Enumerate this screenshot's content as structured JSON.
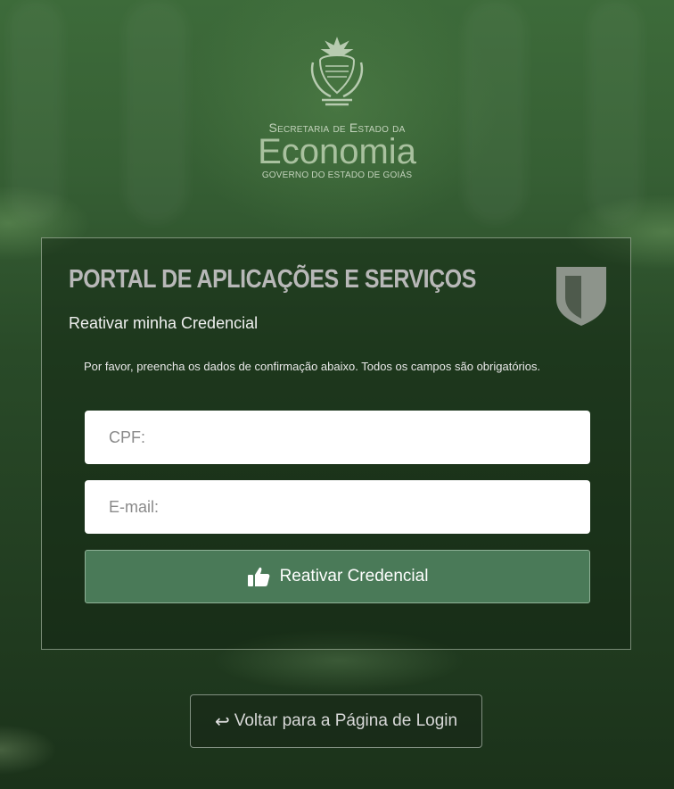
{
  "logo": {
    "line1": "Secretaria de Estado da",
    "line2": "Economia",
    "line3": "GOVERNO DO ESTADO DE GOIÁS"
  },
  "panel": {
    "title": "PORTAL DE APLICAÇÕES E SERVIÇOS",
    "subtitle": "Reativar minha Credencial",
    "instructions": "Por favor, preencha os dados de confirmação abaixo. Todos os campos são obrigatórios.",
    "shield_icon": "shield-icon"
  },
  "form": {
    "cpf_placeholder": "CPF:",
    "cpf_value": "",
    "email_placeholder": "E-mail:",
    "email_value": "",
    "submit_label": "Reativar Credencial",
    "submit_icon": "thumbs-up-icon"
  },
  "footer": {
    "back_label": "Voltar para a Página de Login",
    "back_icon": "reply-arrow-icon"
  },
  "colors": {
    "primary_button": "#4a7a58",
    "background": "#294a28"
  }
}
